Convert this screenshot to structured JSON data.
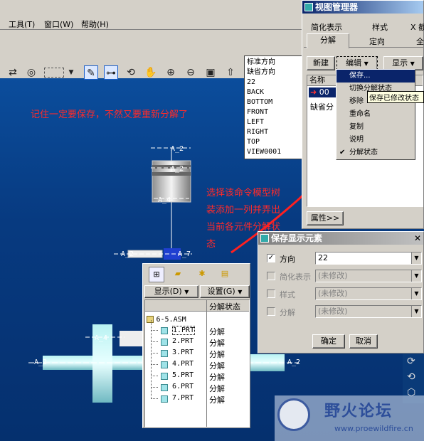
{
  "menubar": {
    "tools": "工具(T)",
    "window": "窗口(W)",
    "help": "帮助(H)"
  },
  "view_list": [
    "标准方向",
    "缺省方向",
    "22",
    "BACK",
    "BOTTOM",
    "FRONT",
    "LEFT",
    "RIGHT",
    "TOP",
    "VIEW0001"
  ],
  "annotations": {
    "note1": "记住一定要保存，不然又要重新分解了",
    "note2_lines": [
      "选择该命令模型树",
      "装添加一列并弄出",
      "当前各元件分解状",
      "态"
    ]
  },
  "model_labels": {
    "a2": "A_2",
    "a4": "A_4",
    "a7": "A_7"
  },
  "view_manager": {
    "title": "视图管理器",
    "tabs_row1": [
      "简化表示",
      "样式",
      "X 截"
    ],
    "tabs_row2": [
      "分解",
      "定向",
      "全"
    ],
    "new_button": "新建",
    "edit_button": "编辑",
    "display_button": "显示",
    "list_header": "名称",
    "selected_row": "00",
    "row_default": "缺省分",
    "properties_button": "属性>>",
    "edit_menu": [
      "保存...",
      "切换分解状态",
      "移除",
      "重命名",
      "复制",
      "说明",
      "分解状态"
    ],
    "tooltip": "保存已修改状态"
  },
  "save_dialog": {
    "title": "保存显示元素",
    "rows": [
      {
        "label": "方向",
        "value": "22",
        "checked": true,
        "enabled": true
      },
      {
        "label": "简化表示",
        "value": "(未修改)",
        "checked": false,
        "enabled": false
      },
      {
        "label": "样式",
        "value": "(未修改)",
        "checked": false,
        "enabled": false
      },
      {
        "label": "分解",
        "value": "(未修改)",
        "checked": false,
        "enabled": false
      }
    ],
    "ok": "确定",
    "cancel": "取消"
  },
  "model_tree": {
    "display_button": "显示(D)",
    "settings_button": "设置(G)",
    "column_header": "分解状态",
    "root": "6-5.ASM",
    "parts": [
      {
        "name": "1.PRT",
        "state": "分解"
      },
      {
        "name": "2.PRT",
        "state": "分解"
      },
      {
        "name": "3.PRT",
        "state": "分解"
      },
      {
        "name": "4.PRT",
        "state": "分解"
      },
      {
        "name": "5.PRT",
        "state": "分解"
      },
      {
        "name": "6.PRT",
        "state": "分解"
      },
      {
        "name": "7.PRT",
        "state": "分解"
      }
    ]
  },
  "watermark": {
    "name": "野火论坛",
    "url": "www.proewildfire.cn"
  }
}
